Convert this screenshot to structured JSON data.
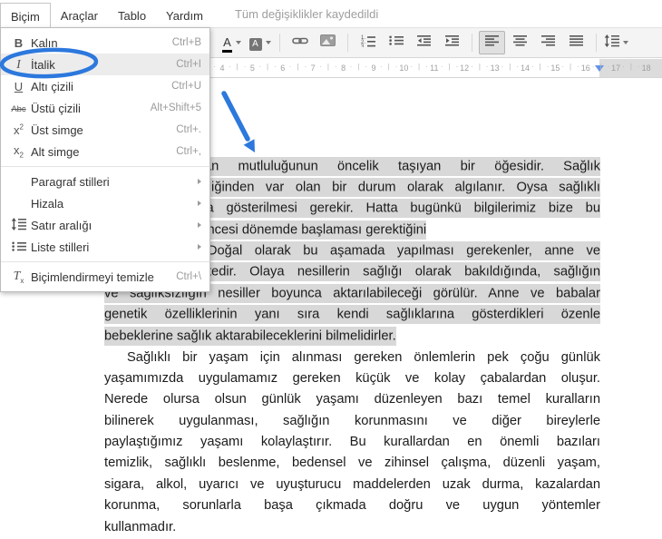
{
  "menu_bar": {
    "items": [
      {
        "label": "Biçim",
        "active": true
      },
      {
        "label": "Araçlar",
        "active": false
      },
      {
        "label": "Tablo",
        "active": false
      },
      {
        "label": "Yardım",
        "active": false
      }
    ],
    "status": "Tüm değişiklikler kaydedildi"
  },
  "format_menu": {
    "items": [
      {
        "type": "item",
        "icon": "bold-icon",
        "label": "Kalın",
        "shortcut": "Ctrl+B"
      },
      {
        "type": "item",
        "icon": "italic-icon",
        "label": "İtalik",
        "shortcut": "Ctrl+I",
        "highlighted": true
      },
      {
        "type": "item",
        "icon": "underline-icon",
        "label": "Altı çizili",
        "shortcut": "Ctrl+U"
      },
      {
        "type": "item",
        "icon": "strikethrough-icon",
        "label": "Üstü çizili",
        "shortcut": "Alt+Shift+5"
      },
      {
        "type": "item",
        "icon": "superscript-icon",
        "label": "Üst simge",
        "shortcut": "Ctrl+."
      },
      {
        "type": "item",
        "icon": "subscript-icon",
        "label": "Alt simge",
        "shortcut": "Ctrl+,"
      },
      {
        "type": "separator"
      },
      {
        "type": "item",
        "label": "Paragraf stilleri",
        "submenu": true
      },
      {
        "type": "item",
        "label": "Hizala",
        "submenu": true
      },
      {
        "type": "item",
        "icon": "line-spacing-icon",
        "label": "Satır aralığı",
        "submenu": true
      },
      {
        "type": "item",
        "icon": "list-styles-icon",
        "label": "Liste stilleri",
        "submenu": true
      },
      {
        "type": "separator"
      },
      {
        "type": "item",
        "icon": "clear-formatting-icon",
        "label": "Biçimlendirmeyi temizle",
        "shortcut": "Ctrl+\\"
      }
    ]
  },
  "toolbar": {
    "buttons": [
      {
        "name": "text-color-button",
        "icon": "text-color-icon",
        "caret": true
      },
      {
        "name": "highlight-color-button",
        "icon": "highlight-color-icon",
        "caret": true
      },
      {
        "sep": true
      },
      {
        "name": "insert-link-button",
        "icon": "link-icon"
      },
      {
        "name": "insert-image-button",
        "icon": "image-icon"
      },
      {
        "sep": true
      },
      {
        "name": "numbered-list-button",
        "icon": "numbered-list-icon"
      },
      {
        "name": "bulleted-list-button",
        "icon": "bulleted-list-icon"
      },
      {
        "name": "decrease-indent-button",
        "icon": "outdent-icon"
      },
      {
        "name": "increase-indent-button",
        "icon": "indent-icon"
      },
      {
        "sep": true
      },
      {
        "name": "align-left-button",
        "icon": "align-left-icon",
        "active": true
      },
      {
        "name": "align-center-button",
        "icon": "align-center-icon"
      },
      {
        "name": "align-right-button",
        "icon": "align-right-icon"
      },
      {
        "name": "align-justify-button",
        "icon": "align-justify-icon"
      },
      {
        "sep": true
      },
      {
        "name": "line-spacing-button",
        "icon": "line-spacing-toolbar-icon",
        "caret": true
      }
    ]
  },
  "ruler": {
    "numbers": [
      4,
      5,
      6,
      7,
      8,
      9,
      10,
      11,
      12,
      13,
      14,
      15,
      16,
      17,
      18
    ]
  },
  "document": {
    "paragraphs": [
      {
        "lines": [
          {
            "text": "Sağlık, insan mutluluğunun öncelik taşıyan bir öğesidir. Sağlık",
            "indent": true,
            "justify": true,
            "highlight": true
          },
          {
            "text": "çoğu kez kendiliğinden var olan bir durum olarak algılanır. Oysa sağlıklı",
            "justify": true,
            "highlight": true
          },
          {
            "text": "olmak için çaba gösterilmesi gerekir. Hatta bugünkü bilgilerimiz bize bu",
            "justify": true,
            "highlight": true
          },
          {
            "text": "çabanın doğum öncesi dönemde başlaması gerektiğini",
            "justify": false,
            "highlight": true
          },
          {
            "text": "göstermektedir. Doğal olarak bu aşamada yapılması gerekenler, anne ve",
            "justify": true,
            "highlight": true
          },
          {
            "text": "babaya düşmektedir. Olaya nesillerin sağlığı olarak bakıldığında, sağlığın",
            "justify": true,
            "highlight": true
          },
          {
            "text": "ve sağlıksızlığın nesiller boyunca aktarılabileceği görülür. Anne ve babalar",
            "justify": true,
            "highlight": true
          },
          {
            "text": "genetik özelliklerinin yanı sıra kendi sağlıklarına gösterdikleri özenle",
            "justify": true,
            "highlight": true
          },
          {
            "text": "bebeklerine sağlık aktarabileceklerini bilmelidirler.",
            "justify": false,
            "highlight": true
          }
        ]
      },
      {
        "lines": [
          {
            "text": "Sağlıklı bir yaşam için alınması gereken önlemlerin pek çoğu günlük",
            "indent": true,
            "justify": true
          },
          {
            "text": "yaşamımızda uygulamamız gereken küçük ve kolay çabalardan oluşur.",
            "justify": true
          },
          {
            "text": "Nerede olursa olsun günlük yaşamı düzenleyen bazı temel kuralların",
            "justify": true
          },
          {
            "text": "bilinerek uygulanması, sağlığın korunmasını ve diğer bireylerle",
            "justify": true
          },
          {
            "text": "paylaştığımız yaşamı kolaylaştırır. Bu kurallardan en önemli bazıları",
            "justify": true
          },
          {
            "text": "temizlik, sağlıklı beslenme, bedensel ve zihinsel çalışma, düzenli yaşam,",
            "justify": true
          },
          {
            "text": "sigara, alkol, uyarıcı ve uyuşturucu maddelerden uzak durma, kazalardan",
            "justify": true
          },
          {
            "text": "korunma, sorunlarla başa çıkmada doğru ve uygun yöntemler",
            "justify": true
          },
          {
            "text": "kullanmadır.",
            "justify": false
          }
        ]
      }
    ]
  },
  "annotations": {
    "accent_color": "#2c78dd",
    "shapes": [
      "circle-highlight-on-italic",
      "arrow-to-text"
    ]
  }
}
